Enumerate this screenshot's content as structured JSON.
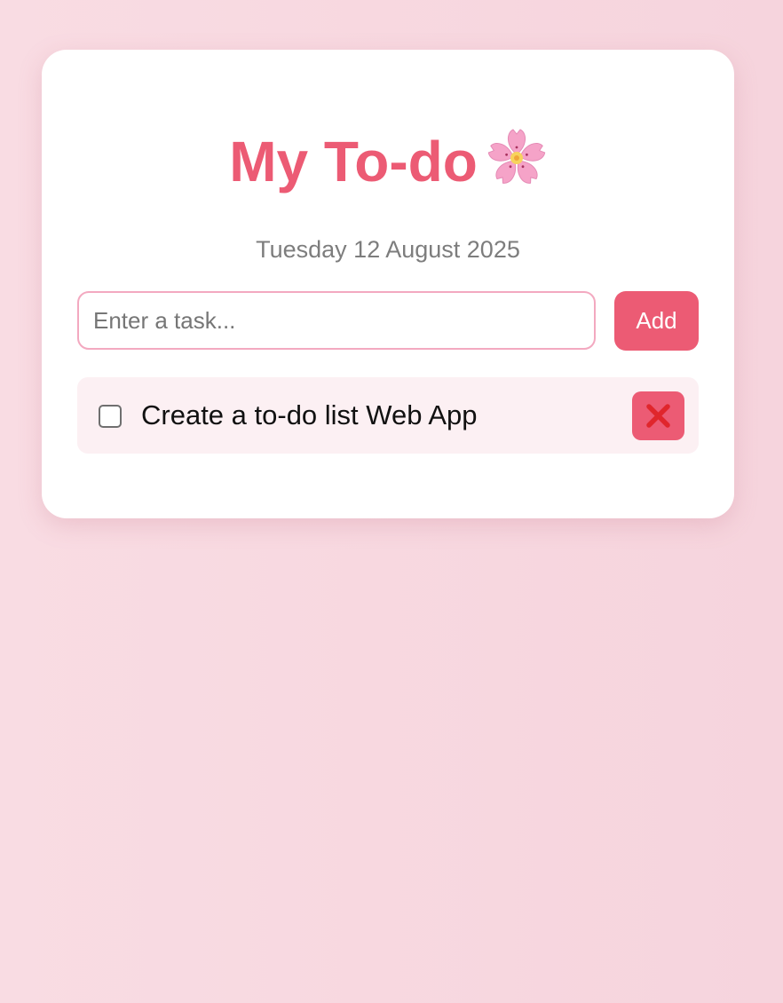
{
  "app": {
    "title": "My To-do",
    "title_icon": "cherry-blossom-icon",
    "date": "Tuesday 12 August 2025"
  },
  "input": {
    "placeholder": "Enter a task...",
    "value": ""
  },
  "add_button": {
    "label": "Add"
  },
  "tasks": [
    {
      "text": "Create a to-do list Web App",
      "done": false,
      "delete_icon": "close-icon"
    }
  ],
  "colors": {
    "accent": "#ec5b74",
    "background": "#f8d8e0",
    "card": "#ffffff",
    "task_background": "#fcf0f3",
    "input_border": "#f3a9c0",
    "delete_cross": "#e0262c"
  }
}
